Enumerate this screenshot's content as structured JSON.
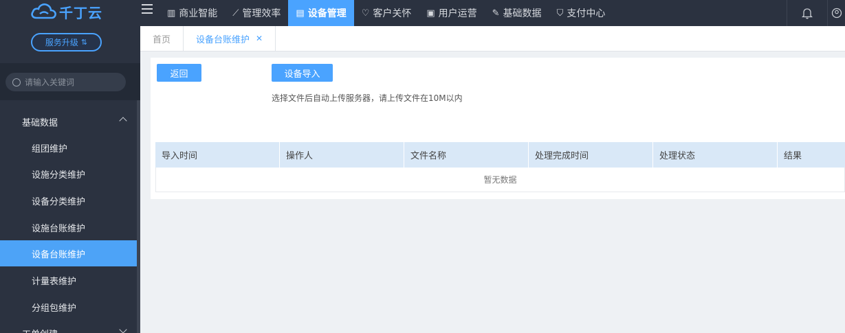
{
  "brand": {
    "name": "千丁云",
    "accent": "#4aa3ff"
  },
  "sidebar": {
    "upgrade_label": "服务升级",
    "search_placeholder": "请输入关键词",
    "group": "基础数据",
    "items": [
      {
        "label": "组团维护"
      },
      {
        "label": "设施分类维护"
      },
      {
        "label": "设备分类维护"
      },
      {
        "label": "设施台账维护"
      },
      {
        "label": "设备台账维护",
        "active": true
      },
      {
        "label": "计量表维护"
      },
      {
        "label": "分组包维护"
      }
    ],
    "next_group": "工单创建"
  },
  "topnav": [
    {
      "label": "商业智能",
      "icon": "building-icon"
    },
    {
      "label": "管理效率",
      "icon": "line-chart-icon"
    },
    {
      "label": "设备管理",
      "icon": "device-icon",
      "active": true
    },
    {
      "label": "客户关怀",
      "icon": "heart-icon"
    },
    {
      "label": "用户运营",
      "icon": "user-card-icon"
    },
    {
      "label": "基础数据",
      "icon": "wrench-icon"
    },
    {
      "label": "支付中心",
      "icon": "yen-shield-icon"
    }
  ],
  "tabs": [
    {
      "label": "首页"
    },
    {
      "label": "设备台账维护",
      "active": true
    }
  ],
  "content": {
    "back_label": "返回",
    "import_label": "设备导入",
    "hint": "选择文件后自动上传服务器，请上传文件在10M以内",
    "table": {
      "columns": [
        "导入时间",
        "操作人",
        "文件名称",
        "处理完成时间",
        "处理状态",
        "结果"
      ],
      "empty_text": "暂无数据"
    }
  }
}
